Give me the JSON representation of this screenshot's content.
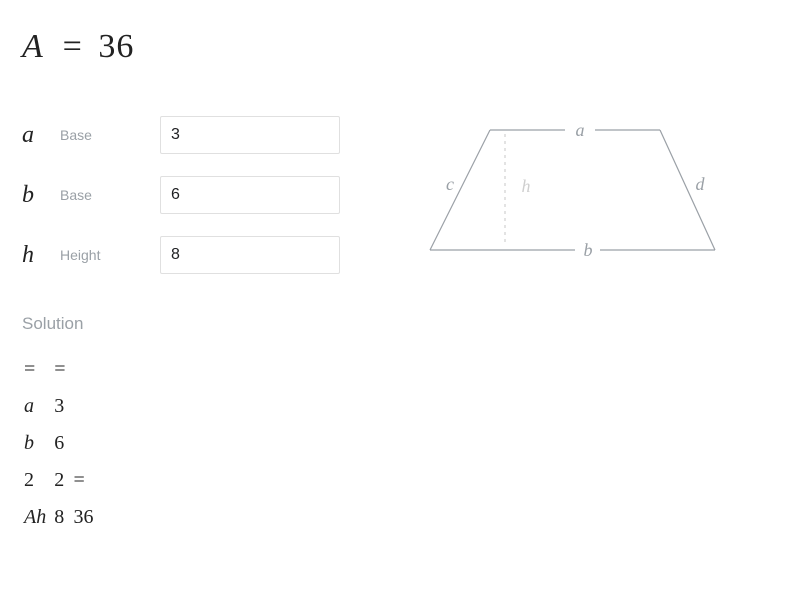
{
  "result": {
    "symbol": "A",
    "equals": "=",
    "value": "36"
  },
  "params": {
    "a": {
      "sym": "a",
      "label": "Base",
      "value": "3"
    },
    "b": {
      "sym": "b",
      "label": "Base",
      "value": "6"
    },
    "h": {
      "sym": "h",
      "label": "Height",
      "value": "8"
    }
  },
  "diagram": {
    "a": "a",
    "b": "b",
    "c": "c",
    "d": "d",
    "h": "h"
  },
  "solution": {
    "heading": "Solution",
    "rows": [
      {
        "c1": "=",
        "c2": "=",
        "c3": ""
      },
      {
        "c1": "a",
        "c2": "3",
        "c3": ""
      },
      {
        "c1": "b",
        "c2": "6",
        "c3": ""
      },
      {
        "c1": "2",
        "c2": "2",
        "c3": "="
      },
      {
        "c1": "Ah",
        "c2": "8",
        "c3": "36"
      }
    ]
  }
}
